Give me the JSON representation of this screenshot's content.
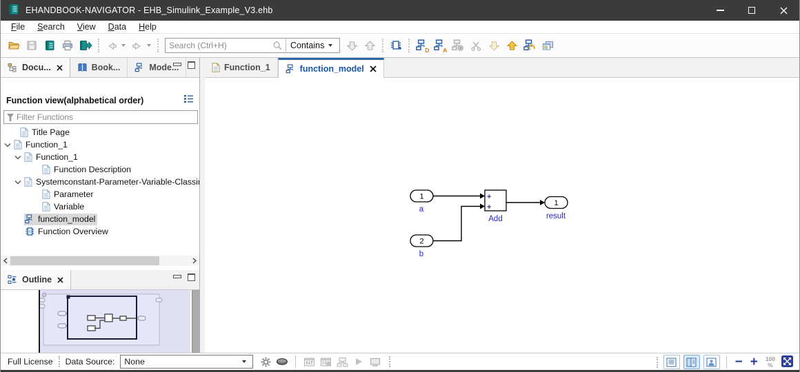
{
  "window": {
    "title": "EHANDBOOK-NAVIGATOR - EHB_Simulink_Example_V3.ehb"
  },
  "menu": {
    "items": [
      "File",
      "Search",
      "View",
      "Data",
      "Help"
    ]
  },
  "toolbar": {
    "search_placeholder": "Search (Ctrl+H)",
    "match_mode": "Contains",
    "badge_d": "D",
    "badge_a": "A",
    "icons": [
      "open-file",
      "save",
      "open-ebook",
      "print",
      "export-ebook",
      "back",
      "forward",
      "search",
      "jump-down",
      "jump-up",
      "add-model-view",
      "model-data",
      "model-labels",
      "model-hide",
      "cut-connections",
      "collapse-down",
      "expand-up",
      "refresh-model",
      "cascade-windows"
    ]
  },
  "left_panel": {
    "tabs": [
      {
        "label": "Docu...",
        "closable": true,
        "active": true
      },
      {
        "label": "Book..."
      },
      {
        "label": "Mode..."
      }
    ],
    "function_view": {
      "title": "Function view(alphabetical order)",
      "filter_placeholder": "Filter Functions",
      "tree": [
        {
          "label": "Title Page",
          "icon": "document",
          "depth": 1
        },
        {
          "label": "Function_1",
          "icon": "document",
          "depth": 0,
          "expanded": true
        },
        {
          "label": "Function_1",
          "icon": "document",
          "depth": 1,
          "expanded": true
        },
        {
          "label": "Function Description",
          "icon": "document",
          "depth": 2
        },
        {
          "label": "Systemconstant-Parameter-Variable-Classin",
          "icon": "document",
          "depth": 1,
          "expanded": true
        },
        {
          "label": "Parameter",
          "icon": "document",
          "depth": 2
        },
        {
          "label": "Variable",
          "icon": "document",
          "depth": 2
        },
        {
          "label": "function_model",
          "icon": "model",
          "depth": 1,
          "selected": true
        },
        {
          "label": "Function Overview",
          "icon": "chip",
          "depth": 1
        }
      ]
    },
    "outline": {
      "tab_label": "Outline"
    }
  },
  "main": {
    "tabs": [
      {
        "label": "Function_1"
      },
      {
        "label": "function_model",
        "active": true,
        "closable": true
      }
    ],
    "diagram": {
      "inport1": {
        "port": "1",
        "name": "a"
      },
      "inport2": {
        "port": "2",
        "name": "b"
      },
      "sum_block": {
        "name": "Add",
        "op_top": "+",
        "op_bottom": "+"
      },
      "outport": {
        "port": "1",
        "name": "result"
      }
    }
  },
  "status_bar": {
    "license": "Full License",
    "data_source_label": "Data Source:",
    "data_source_value": "None",
    "zoom_value": "100",
    "zoom_percent": "%"
  },
  "colors": {
    "titlebar": "#3b3b3b",
    "accent_blue": "#2a5fa5",
    "active_tab_top": "#2a67a9",
    "diagram_label_blue": "#2626d6",
    "tree_selection": "#d9d9d9",
    "outline_thumbnail_bg": "#dfe1f3"
  }
}
